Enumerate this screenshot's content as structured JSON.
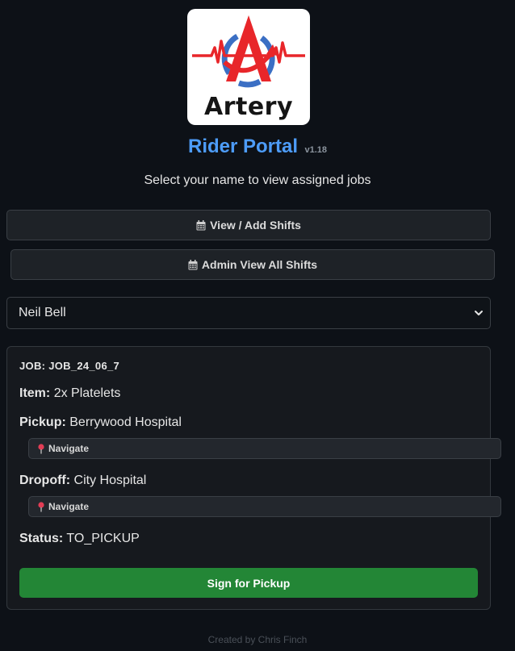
{
  "logo": {
    "wordmark": "Artery",
    "colors": {
      "red": "#e8262a",
      "blue": "#3b6fc4"
    }
  },
  "header": {
    "title": "Rider Portal",
    "version": "v1.18",
    "subtitle": "Select your name to view assigned jobs"
  },
  "buttons": {
    "shifts": "View / Add Shifts",
    "admin": "Admin View All Shifts"
  },
  "rider_select": {
    "selected": "Neil Bell"
  },
  "job": {
    "id_label": "JOB:",
    "id": "JOB_24_06_7",
    "item_label": "Item:",
    "item": "2x Platelets",
    "pickup_label": "Pickup:",
    "pickup": "Berrywood Hospital",
    "navigate_label": "Navigate",
    "dropoff_label": "Dropoff:",
    "dropoff": "City Hospital",
    "status_label": "Status:",
    "status": "TO_PICKUP",
    "action": "Sign for Pickup"
  },
  "footer": {
    "text": "Created by Chris Finch"
  },
  "theme": {
    "accent": "#4d9cf8",
    "success": "#238636",
    "background": "#0d1117"
  }
}
